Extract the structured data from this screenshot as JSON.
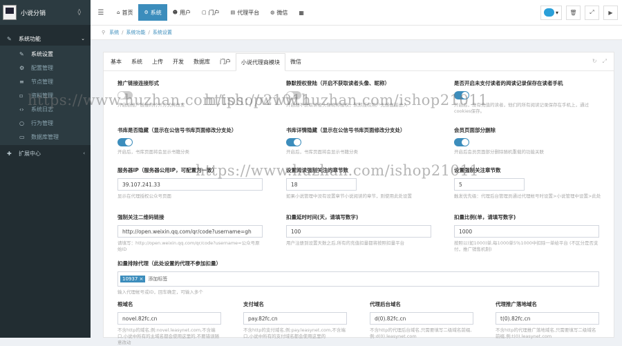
{
  "app": {
    "title": "小说分销"
  },
  "sidebar": {
    "items": [
      {
        "label": "系统功能",
        "icon": "wrench-icon",
        "arrow": "⌄"
      },
      {
        "label": "系统设置"
      },
      {
        "label": "配置管理"
      },
      {
        "label": "节点管理"
      },
      {
        "label": "资料管理"
      },
      {
        "label": "系统日志"
      },
      {
        "label": "行为管理"
      },
      {
        "label": "数据库管理"
      },
      {
        "label": "扩展中心",
        "arrow": "‹"
      }
    ]
  },
  "header": {
    "tabs": [
      {
        "label": "首页"
      },
      {
        "label": "系统"
      },
      {
        "label": "用户"
      },
      {
        "label": "门户"
      },
      {
        "label": "代理平台"
      },
      {
        "label": "微信"
      }
    ]
  },
  "breadcrumb": [
    "系统",
    "系统功能",
    "系统设置"
  ],
  "panel": {
    "tabs": [
      "基本",
      "系统",
      "上传",
      "开发",
      "数据库",
      "门户",
      "小说代理商模块",
      "微信"
    ]
  },
  "form": {
    "f1": {
      "label": "推广链接连接形式",
      "help": "开启后推广链接的打开方式将改变"
    },
    "f2": {
      "label": "静默授权登陆（开启不获取读者头像、昵称）",
      "help": "开启后不获取读者头像昵称授权，默默授权用户无感直接进入"
    },
    "f3": {
      "label": "是否开启未支付读者的阅读记录保存在读者手机",
      "help": "开启后，没有充值的读者，他们的所有阅读记录保存在手机上，通过cookies保存。"
    },
    "f4": {
      "label": "书库是否隐藏（显示在公信号书库页面修改分支处）",
      "help": "开启后，书库页面将会显示书籍分类"
    },
    "f5": {
      "label": "书库详情隐藏（显示在公信号书库页面修改分支处）",
      "help": "开启后，书库页面将会显示书籍分类"
    },
    "f6": {
      "label": "会员页面部分删除",
      "help": "开启后会员页面部分删除随机重载的功能关联"
    },
    "f7": {
      "label": "服务器IP（服务器公用IP，可配置为一致）",
      "value": "39.107.241.33",
      "help": "显示在代理授权公众号页面"
    },
    "f8": {
      "label": "设置阅读强制关注的章节数",
      "value": "18",
      "help": "如果小说管理中没有设置章节小说阅读的章节，则使用此处设置"
    },
    "f9": {
      "label": "设置强制关注章节数",
      "value": "5",
      "help": "触发优先级：代理后台管理员通过代理帐号时设置>小说管理中设置>此处"
    },
    "f10": {
      "label": "强制关注二维码链接",
      "value": "http://open.weixin.qq.com/qr/code?username=gh",
      "help": "请填写：http://open.weixin.qq.com/qr/code?username=公众号原始ID"
    },
    "f11": {
      "label": "扣量延时时间(天，请填写数字)",
      "value": "100",
      "help": "用户注册到设置天数之后,所有的充值扣量都将按照扣量平台"
    },
    "f12": {
      "label": "扣量比例(单，请填写数字)",
      "value": "1000",
      "help": "按照以(如1000)单,每1000单5％1000中扣除一单给平台 (不区分是否支付，推广销售机制)"
    },
    "f13": {
      "label": "扣量排除代理（此处设置的代理不参加扣量）",
      "tag": "10937",
      "tag_x": "×",
      "tag_add": "添加标签",
      "help": "输入代理帐号或ID，回车确定，可输入多个"
    },
    "f14": {
      "label": "根域名",
      "value": "novel.82fc.cn",
      "help": "不含http的域名,例:novel.leasynet.com,不含端口,小说中所有的主域名都会使用这里的,不要错误随意改动"
    },
    "f15": {
      "label": "支付域名",
      "value": "pay.82fc.cn",
      "help": "不含http的支付域名,例:pay.leasynet.com,不含端口,小说中所有的支付域名都会使用这里的"
    },
    "f16": {
      "label": "代理后台域名",
      "value": "d(0).82fc.cn",
      "help": "不含http的代理后台域名,只需要填写二级域名前缀,例:d(0).leasynet.com"
    },
    "f17": {
      "label": "代理推广落地域名",
      "value": "t(0).82fc.cn",
      "help": "不含http的代理推广落地域名,只需要填写二级域名前缀,例:t(0).leasynet.com"
    }
  },
  "watermark": {
    "text": "https://www.huzhan.com/ishop21011"
  }
}
